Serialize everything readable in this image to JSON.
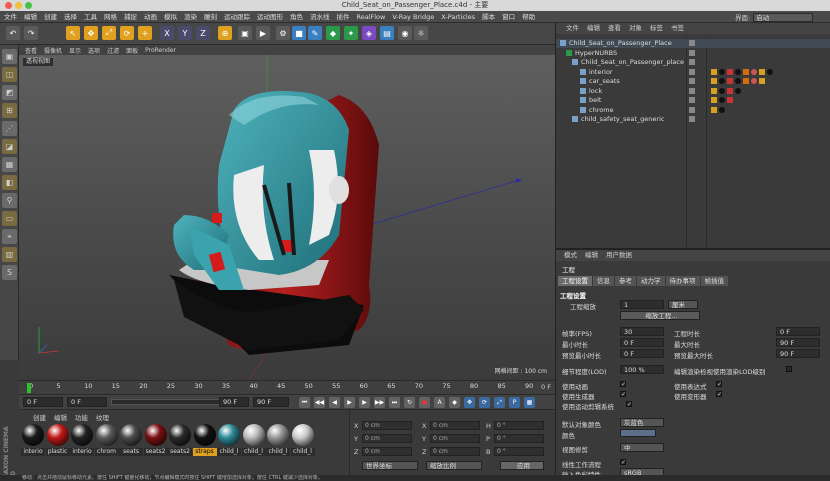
{
  "window": {
    "title": "Child_Seat_on_Passenger_Place.c4d - 主要"
  },
  "menu": [
    "文件",
    "编辑",
    "创建",
    "选择",
    "工具",
    "网格",
    "捕捉",
    "动画",
    "模拟",
    "渲染",
    "雕刻",
    "运动跟踪",
    "运动图形",
    "角色",
    "流水线",
    "插件",
    "RealFlow",
    "V-Ray Bridge",
    "X-Particles",
    "脚本",
    "窗口",
    "帮助"
  ],
  "layout": {
    "label": "界面:",
    "value": "启动"
  },
  "viewport": {
    "menu": [
      "查看",
      "摄像机",
      "显示",
      "选项",
      "过滤",
      "面板",
      "ProRender"
    ],
    "label": "透视视图",
    "grid": "网格间距 : 100 cm"
  },
  "timeline": {
    "ticks": [
      "0",
      "5",
      "10",
      "15",
      "20",
      "25",
      "30",
      "35",
      "40",
      "45",
      "50",
      "55",
      "60",
      "65",
      "70",
      "75",
      "80",
      "85",
      "90"
    ],
    "end": "0 F"
  },
  "transport": {
    "start": "0 F",
    "current": "0 F",
    "end": "90 F",
    "end2": "90 F"
  },
  "materials": {
    "menu": [
      "创建",
      "编辑",
      "功能",
      "纹理"
    ],
    "items": [
      {
        "name": "interio",
        "color": "#1a1a1a"
      },
      {
        "name": "plastic",
        "color": "#c01818"
      },
      {
        "name": "interio",
        "color": "#222"
      },
      {
        "name": "chrom",
        "color": "#5a5a5a"
      },
      {
        "name": "seats",
        "color": "#4a4a4a"
      },
      {
        "name": "seats2",
        "color": "#7a1010"
      },
      {
        "name": "seats2",
        "color": "#2a2a2a"
      },
      {
        "name": "straps",
        "color": "#111"
      },
      {
        "name": "child_l",
        "color": "#2e8a95"
      },
      {
        "name": "child_l",
        "color": "#bbb"
      },
      {
        "name": "child_l",
        "color": "#999"
      },
      {
        "name": "child_l",
        "color": "#ccc"
      }
    ],
    "brand": "MAXON CINEMA 4D"
  },
  "coords": {
    "rows": [
      {
        "a": "X",
        "v1": "0 cm",
        "b": "X",
        "v2": "0 cm",
        "c": "H",
        "v3": "0 °"
      },
      {
        "a": "Y",
        "v1": "0 cm",
        "b": "Y",
        "v2": "0 cm",
        "c": "P",
        "v3": "0 °"
      },
      {
        "a": "Z",
        "v1": "0 cm",
        "b": "Z",
        "v2": "0 cm",
        "c": "B",
        "v3": "0 °"
      }
    ],
    "world": "世界坐标",
    "scale": "缩放比例",
    "apply": "应用"
  },
  "objects": {
    "menu": [
      "文件",
      "编辑",
      "查看",
      "对象",
      "标签",
      "书签"
    ],
    "rows": [
      {
        "name": "Child_Seat_on_Passenger_Place",
        "indent": 4
      },
      {
        "name": "HyperNURBS",
        "indent": 10
      },
      {
        "name": "Child_Seat_on_Passenger_place",
        "indent": 16
      },
      {
        "name": "interior",
        "indent": 24
      },
      {
        "name": "car_seats",
        "indent": 24
      },
      {
        "name": "lock",
        "indent": 24
      },
      {
        "name": "belt",
        "indent": 24
      },
      {
        "name": "chrome",
        "indent": 24
      },
      {
        "name": "child_safety_seat_generic",
        "indent": 16
      }
    ]
  },
  "attributes": {
    "menu": [
      "模式",
      "编辑",
      "用户数据"
    ],
    "title": "工程",
    "tabs": [
      "工程设置",
      "信息",
      "参考",
      "动力学",
      "待办事项",
      "帧插值"
    ],
    "section": "工程设置",
    "scale_label": "工程缩放",
    "scale_value": "1",
    "scale_unit": "厘米",
    "scale_btn": "缩放工程...",
    "fps_label": "帧率(FPS)",
    "fps": "30",
    "duration_label": "工程时长",
    "duration": "0 F",
    "min_label": "最小时长",
    "min": "0 F",
    "max_label": "最大时长",
    "max": "90 F",
    "pmin_label": "预览最小时长",
    "pmin": "0 F",
    "pmax_label": "预览最大时长",
    "pmax": "90 F",
    "lod_label": "细节程度(LOD)",
    "lod": "100 %",
    "lod_note": "编辑渲染检视使用渲染LOD级别",
    "anim": "使用动画",
    "expr": "使用表达式",
    "gen": "使用生成器",
    "deform": "使用变形器",
    "motion": "使用运动剪辑系统",
    "defcolor_label": "默认对象颜色",
    "defcolor": "灰蓝色",
    "color_label": "颜色",
    "view_label": "视图修剪",
    "view": "中",
    "linear_label": "线性工作流程",
    "input_label": "输入色彩特性",
    "input": "sRGB"
  },
  "status": "移动：点击并拖动鼠标移动元素。按住 SHIFT 键量化移动；节点编辑模式时按住 SHIFT 键增加选择对象；按住 CTRL 键减少选择对象。",
  "colors": {
    "accent": "#2e8a95",
    "red": "#b01818"
  }
}
